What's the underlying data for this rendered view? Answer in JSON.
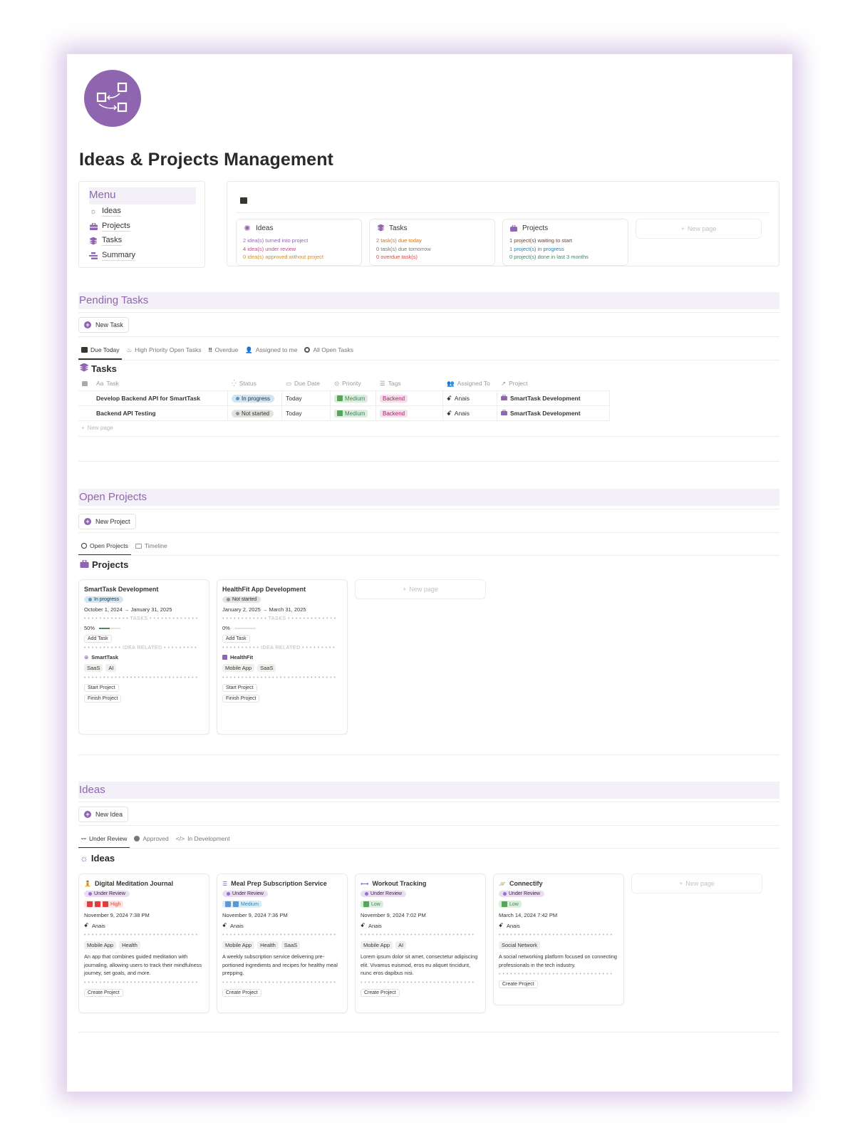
{
  "page": {
    "title": "Ideas & Projects Management",
    "accent": "#9065b0"
  },
  "menu": {
    "title": "Menu",
    "items": [
      {
        "label": "Ideas",
        "icon": "sun-icon"
      },
      {
        "label": "Projects",
        "icon": "briefcase-icon"
      },
      {
        "label": "Tasks",
        "icon": "layers-icon"
      },
      {
        "label": "Summary",
        "icon": "summary-icon"
      }
    ]
  },
  "stats": {
    "cards": [
      {
        "title": "Ideas",
        "icon": "sun-icon",
        "lines": [
          {
            "text": "2 idea(s) turned into project",
            "color": "#9065b0"
          },
          {
            "text": "4 idea(s) under review",
            "color": "#c14c8a"
          },
          {
            "text": "0 idea(s) approved without project",
            "color": "#cb912f"
          }
        ]
      },
      {
        "title": "Tasks",
        "icon": "layers-icon",
        "lines": [
          {
            "text": "2 task(s) due today",
            "color": "#d9730d"
          },
          {
            "text": "0 task(s) due tomorrow",
            "color": "#787774"
          },
          {
            "text": "0 overdue task(s)",
            "color": "#d44c47"
          }
        ]
      },
      {
        "title": "Projects",
        "icon": "briefcase-icon",
        "lines": [
          {
            "text": "1 project(s) waiting to start",
            "color": "#64473a"
          },
          {
            "text": "1 project(s) in progress",
            "color": "#337ea9"
          },
          {
            "text": "0 project(s) done in last 3 months",
            "color": "#448361"
          }
        ]
      }
    ],
    "new_page": "New page"
  },
  "pending_tasks": {
    "heading": "Pending Tasks",
    "new_button": "New Task",
    "tabs": [
      "Due Today",
      "High Priority Open Tasks",
      "Overdue",
      "Assigned to me",
      "All Open Tasks"
    ],
    "db_title": "Tasks",
    "columns": [
      "Task",
      "Status",
      "Due Date",
      "Priority",
      "Tags",
      "Assigned To",
      "Project"
    ],
    "rows": [
      {
        "task": "Develop Backend API for SmartTask",
        "status": "In progress",
        "due": "Today",
        "priority": "Medium",
        "tag": "Backend",
        "assignee": "Anais",
        "project": "SmartTask Development"
      },
      {
        "task": "Backend API Testing",
        "status": "Not started",
        "due": "Today",
        "priority": "Medium",
        "tag": "Backend",
        "assignee": "Anais",
        "project": "SmartTask Development"
      }
    ],
    "new_row": "New page"
  },
  "open_projects": {
    "heading": "Open Projects",
    "new_button": "New Project",
    "tabs": [
      "Open Projects",
      "Timeline"
    ],
    "db_title": "Projects",
    "cards": [
      {
        "name": "SmartTask Development",
        "status": "In progress",
        "dates": "October 1, 2024 → January 31, 2025",
        "tasks_label": "TASKS",
        "progress": "50%",
        "progress_value": 0.5,
        "add_task": "Add Task",
        "idea_label": "IDEA RELATED",
        "idea": "SmartTask",
        "tags": [
          "SaaS",
          "AI"
        ],
        "start": "Start Project",
        "finish": "Finish Project"
      },
      {
        "name": "HealthFit App Development",
        "status": "Not started",
        "dates": "January 2, 2025 → March 31, 2025",
        "tasks_label": "TASKS",
        "progress": "0%",
        "progress_value": 0,
        "add_task": "Add Task",
        "idea_label": "IDEA RELATED",
        "idea": "HealthFit",
        "tags": [
          "Mobile App",
          "SaaS"
        ],
        "start": "Start Project",
        "finish": "Finish Project"
      }
    ],
    "new_page": "New page"
  },
  "ideas": {
    "heading": "Ideas",
    "new_button": "New Idea",
    "tabs": [
      "Under Review",
      "Approved",
      "In Development"
    ],
    "db_title": "Ideas",
    "cards": [
      {
        "name": "Digital Meditation Journal",
        "icon": "meditation-icon",
        "status": "Under Review",
        "priority": "High",
        "date": "November 9, 2024 7:38 PM",
        "assignee": "Anais",
        "tags": [
          "Mobile App",
          "Health"
        ],
        "desc": "An app that combines guided meditation with journaling, allowing users to track their mindfulness journey, set goals, and more.",
        "button": "Create Project"
      },
      {
        "name": "Meal Prep Subscription Service",
        "icon": "burger-icon",
        "status": "Under Review",
        "priority": "Medium",
        "date": "November 9, 2024 7:36 PM",
        "assignee": "Anais",
        "tags": [
          "Mobile App",
          "Health",
          "SaaS"
        ],
        "desc": "A weekly subscription service delivering pre-portioned ingredients and recipes for healthy meal prepping.",
        "button": "Create Project"
      },
      {
        "name": "Workout Tracking",
        "icon": "dumbbell-icon",
        "status": "Under Review",
        "priority": "Low",
        "date": "November 9, 2024 7:02 PM",
        "assignee": "Anais",
        "tags": [
          "Mobile App",
          "AI"
        ],
        "desc": "Lorem ipsum dolor sit amet, consectetur adipiscing elit. Vivamus euismod, eros eu aliquet tincidunt, nunc eros dapibus nisi.",
        "button": "Create Project"
      },
      {
        "name": "Connectify",
        "icon": "planet-icon",
        "status": "Under Review",
        "priority": "Low",
        "date": "March 14, 2024 7:42 PM",
        "assignee": "Anais",
        "tags": [
          "Social Network"
        ],
        "desc": " A social networking platform focused on connecting professionals in the tech industry.",
        "button": "Create Project"
      }
    ],
    "new_page": "New page"
  }
}
